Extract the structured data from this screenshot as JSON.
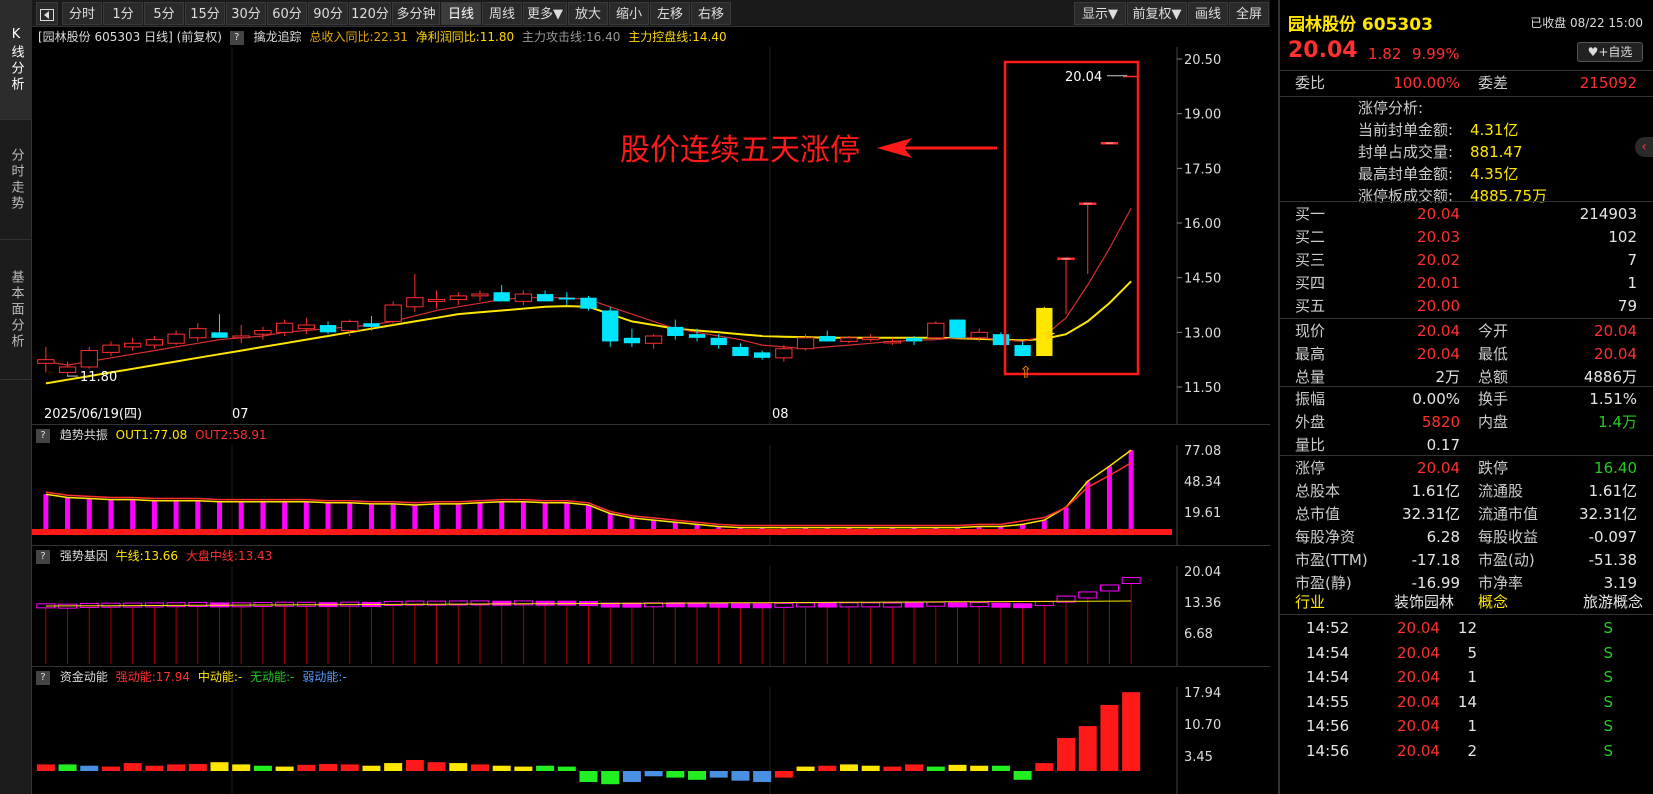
{
  "left_tabs": [
    "K线分析",
    "分时走势",
    "基本面分析"
  ],
  "toolbar": {
    "periods": [
      "分时",
      "1分",
      "5分",
      "15分",
      "30分",
      "60分",
      "90分",
      "120分",
      "多分钟",
      "日线",
      "周线",
      "更多▼",
      "放大",
      "缩小",
      "左移",
      "右移"
    ],
    "active": "日线",
    "right_buttons": [
      "显示▼",
      "前复权▼",
      "画线",
      "全屏"
    ]
  },
  "kline_header": {
    "title": "[园林股份 605303 日线] (前复权)",
    "indicator": "擒龙追踪",
    "revenue": "总收入同比:22.31",
    "profit": "净利润同比:11.80",
    "attack": "主力攻击线:16.40",
    "control": "主力控盘线:14.40"
  },
  "kline": {
    "annotation": "股价连续五天涨停",
    "high_label": "20.04",
    "low_label": "11.80",
    "date_label": "2025/06/19(四)",
    "month_labels": [
      "07",
      "08"
    ],
    "y_ticks": [
      "20.50",
      "19.00",
      "17.50",
      "16.00",
      "14.50",
      "13.00",
      "11.50"
    ],
    "y_values": [
      20.5,
      19.0,
      17.5,
      16.0,
      14.5,
      13.0,
      11.5
    ],
    "candles": [
      [
        12.15,
        12.6,
        11.9,
        12.25
      ],
      [
        11.9,
        12.2,
        11.8,
        12.05
      ],
      [
        12.05,
        12.6,
        12.0,
        12.5
      ],
      [
        12.45,
        12.75,
        12.35,
        12.65
      ],
      [
        12.6,
        12.85,
        12.5,
        12.7
      ],
      [
        12.65,
        12.9,
        12.55,
        12.8
      ],
      [
        12.7,
        13.05,
        12.65,
        12.95
      ],
      [
        12.85,
        13.25,
        12.75,
        13.1
      ],
      [
        13.0,
        13.5,
        12.85,
        12.85
      ],
      [
        12.85,
        13.2,
        12.7,
        12.9
      ],
      [
        12.95,
        13.15,
        12.8,
        13.05
      ],
      [
        13.0,
        13.35,
        12.9,
        13.25
      ],
      [
        13.1,
        13.4,
        12.95,
        13.2
      ],
      [
        13.2,
        13.3,
        12.95,
        13.0
      ],
      [
        13.05,
        13.35,
        12.9,
        13.3
      ],
      [
        13.25,
        13.45,
        13.05,
        13.15
      ],
      [
        13.3,
        13.85,
        13.2,
        13.75
      ],
      [
        13.7,
        14.6,
        13.55,
        13.95
      ],
      [
        13.85,
        14.15,
        13.65,
        13.9
      ],
      [
        13.9,
        14.1,
        13.75,
        14.0
      ],
      [
        14.0,
        14.15,
        13.85,
        14.05
      ],
      [
        14.1,
        14.3,
        13.85,
        13.85
      ],
      [
        13.85,
        14.15,
        13.75,
        14.05
      ],
      [
        14.05,
        14.15,
        13.85,
        13.85
      ],
      [
        13.95,
        14.1,
        13.75,
        13.9
      ],
      [
        13.95,
        14.0,
        13.6,
        13.65
      ],
      [
        13.6,
        13.7,
        12.6,
        12.75
      ],
      [
        12.85,
        13.1,
        12.6,
        12.7
      ],
      [
        12.7,
        12.95,
        12.55,
        12.9
      ],
      [
        13.15,
        13.35,
        12.8,
        12.9
      ],
      [
        12.95,
        13.1,
        12.75,
        12.85
      ],
      [
        12.85,
        12.95,
        12.55,
        12.65
      ],
      [
        12.6,
        12.7,
        12.35,
        12.35
      ],
      [
        12.45,
        12.5,
        12.25,
        12.3
      ],
      [
        12.3,
        12.65,
        12.2,
        12.55
      ],
      [
        12.55,
        12.95,
        12.5,
        12.85
      ],
      [
        12.9,
        13.05,
        12.75,
        12.75
      ],
      [
        12.75,
        12.9,
        12.7,
        12.85
      ],
      [
        12.8,
        12.95,
        12.75,
        12.85
      ],
      [
        12.75,
        12.85,
        12.65,
        12.75
      ],
      [
        12.85,
        12.9,
        12.65,
        12.75
      ],
      [
        12.85,
        13.3,
        12.85,
        13.25
      ],
      [
        13.35,
        13.35,
        12.85,
        12.85
      ],
      [
        12.85,
        13.1,
        12.75,
        13.0
      ],
      [
        12.95,
        13.0,
        12.65,
        12.65
      ],
      [
        12.65,
        12.75,
        12.35,
        12.35
      ],
      [
        12.35,
        13.7,
        12.35,
        13.67
      ],
      [
        15.04,
        15.04,
        13.5,
        15.04
      ],
      [
        16.55,
        16.55,
        14.6,
        16.55
      ],
      [
        18.21,
        18.21,
        18.21,
        18.21
      ],
      [
        20.04,
        20.04,
        20.04,
        20.04
      ]
    ],
    "ma_short": [
      12.2,
      12.1,
      12.2,
      12.3,
      12.4,
      12.5,
      12.6,
      12.7,
      12.8,
      12.85,
      12.9,
      13.0,
      13.05,
      13.1,
      13.15,
      13.2,
      13.3,
      13.45,
      13.6,
      13.7,
      13.8,
      13.9,
      13.95,
      13.95,
      13.95,
      13.9,
      13.7,
      13.5,
      13.3,
      13.1,
      13.0,
      12.9,
      12.8,
      12.65,
      12.6,
      12.55,
      12.6,
      12.65,
      12.7,
      12.75,
      12.78,
      12.8,
      12.85,
      12.85,
      12.8,
      12.75,
      12.9,
      13.4,
      14.3,
      15.3,
      16.4
    ],
    "ma_long": [
      11.6,
      11.7,
      11.8,
      11.9,
      12.0,
      12.1,
      12.2,
      12.3,
      12.4,
      12.5,
      12.6,
      12.7,
      12.8,
      12.9,
      13.0,
      13.1,
      13.2,
      13.3,
      13.4,
      13.5,
      13.55,
      13.6,
      13.65,
      13.7,
      13.72,
      13.7,
      13.5,
      13.3,
      13.2,
      13.1,
      13.05,
      13.0,
      12.95,
      12.9,
      12.88,
      12.87,
      12.85,
      12.85,
      12.85,
      12.85,
      12.85,
      12.85,
      12.84,
      12.82,
      12.8,
      12.78,
      12.82,
      12.95,
      13.3,
      13.8,
      14.4
    ]
  },
  "trend_panel": {
    "name": "趋势共振",
    "out1": "OUT1:77.08",
    "out2": "OUT2:58.91",
    "y_ticks": [
      "77.08",
      "48.34",
      "19.61"
    ],
    "values": [
      36,
      33,
      32,
      31,
      31,
      30,
      30,
      30,
      29,
      29,
      29,
      29,
      29,
      28,
      28,
      27,
      27,
      26,
      27,
      27,
      28,
      29,
      29,
      28,
      28,
      26,
      18,
      14,
      12,
      10,
      8,
      6,
      5,
      5,
      5,
      5,
      5,
      5,
      5,
      5,
      5,
      5,
      5,
      6,
      6,
      8,
      12,
      24,
      48,
      62,
      77
    ]
  },
  "gene_panel": {
    "name": "强势基因",
    "niu": "牛线:13.66",
    "dapan": "大盘中线:13.43",
    "y_ticks": [
      "20.04",
      "13.36",
      "6.68"
    ]
  },
  "fund_panel": {
    "name": "资金动能",
    "strong": "强动能:17.94",
    "mid": "中动能:-",
    "none": "无动能:-",
    "weak": "弱动能:-",
    "y_ticks": [
      "17.94",
      "10.70",
      "3.45"
    ],
    "values": [
      1.5,
      1.5,
      1.2,
      1.0,
      1.8,
      1.2,
      1.5,
      1.6,
      2.0,
      1.5,
      1.2,
      1.0,
      1.4,
      1.6,
      1.5,
      1.2,
      1.8,
      2.5,
      2.0,
      1.8,
      1.5,
      1.2,
      1.0,
      1.2,
      1.0,
      -2.5,
      -3.0,
      -2.5,
      -1.2,
      -1.5,
      -2.0,
      -1.5,
      -2.2,
      -2.5,
      -1.5,
      1.0,
      1.2,
      1.5,
      1.2,
      1.0,
      1.5,
      1.0,
      1.4,
      1.2,
      1.2,
      -2.0,
      1.8,
      7.5,
      10.2,
      15.0,
      17.9
    ],
    "colors": [
      "r",
      "g",
      "b",
      "r",
      "r",
      "r",
      "r",
      "r",
      "y",
      "y",
      "g",
      "y",
      "r",
      "r",
      "r",
      "y",
      "y",
      "r",
      "r",
      "y",
      "r",
      "y",
      "y",
      "g",
      "g",
      "g",
      "g",
      "b",
      "b",
      "g",
      "g",
      "b",
      "b",
      "b",
      "r",
      "y",
      "r",
      "y",
      "y",
      "r",
      "r",
      "g",
      "y",
      "y",
      "g",
      "g",
      "r",
      "r",
      "r",
      "r",
      "r"
    ]
  },
  "quote": {
    "name": "园林股份",
    "code": "605303",
    "status": "已收盘 08/22 15:00",
    "price": "20.04",
    "change": "1.82",
    "pct": "9.99%",
    "fav": "+自选",
    "weibi_label": "委比",
    "weibi": "100.00%",
    "weicha_label": "委差",
    "weicha": "215092",
    "zt_title": "涨停分析:",
    "zt": [
      {
        "label": "当前封单金额:",
        "value": "4.31亿"
      },
      {
        "label": "封单占成交量:",
        "value": "881.47"
      },
      {
        "label": "最高封单金额:",
        "value": "4.35亿"
      },
      {
        "label": "涨停板成交额:",
        "value": "4885.75万"
      }
    ],
    "buys": [
      {
        "label": "买一",
        "price": "20.04",
        "vol": "214903"
      },
      {
        "label": "买二",
        "price": "20.03",
        "vol": "102"
      },
      {
        "label": "买三",
        "price": "20.02",
        "vol": "7"
      },
      {
        "label": "买四",
        "price": "20.01",
        "vol": "1"
      },
      {
        "label": "买五",
        "price": "20.00",
        "vol": "79"
      }
    ],
    "stats1": [
      [
        "现价",
        "20.04",
        "r",
        "今开",
        "20.04",
        "r"
      ],
      [
        "最高",
        "20.04",
        "r",
        "最低",
        "20.04",
        "r"
      ],
      [
        "总量",
        "2万",
        "w",
        "总额",
        "4886万",
        "w"
      ]
    ],
    "stats2": [
      [
        "振幅",
        "0.00%",
        "w",
        "换手",
        "1.51%",
        "w"
      ],
      [
        "外盘",
        "5820",
        "r",
        "内盘",
        "1.4万",
        "g"
      ],
      [
        "量比",
        "0.17",
        "w",
        "",
        "",
        ""
      ]
    ],
    "stats3": [
      [
        "涨停",
        "20.04",
        "r",
        "跌停",
        "16.40",
        "g"
      ],
      [
        "总股本",
        "1.61亿",
        "w",
        "流通股",
        "1.61亿",
        "w"
      ],
      [
        "总市值",
        "32.31亿",
        "w",
        "流通市值",
        "32.31亿",
        "w"
      ],
      [
        "每股净资",
        "6.28",
        "w",
        "每股收益",
        "-0.097",
        "w"
      ],
      [
        "市盈(TTM)",
        "-17.18",
        "w",
        "市盈(动)",
        "-51.38",
        "w"
      ],
      [
        "市盈(静)",
        "-16.99",
        "w",
        "市净率",
        "3.19",
        "w"
      ]
    ],
    "industry_label": "行业",
    "industry": "装饰园林",
    "concept_label": "概念",
    "concept": "旅游概念",
    "ticks": [
      [
        "14:52",
        "20.04",
        "12",
        "S"
      ],
      [
        "14:54",
        "20.04",
        "5",
        "S"
      ],
      [
        "14:54",
        "20.04",
        "1",
        "S"
      ],
      [
        "14:55",
        "20.04",
        "14",
        "S"
      ],
      [
        "14:56",
        "20.04",
        "1",
        "S"
      ],
      [
        "14:56",
        "20.04",
        "2",
        "S"
      ]
    ]
  }
}
